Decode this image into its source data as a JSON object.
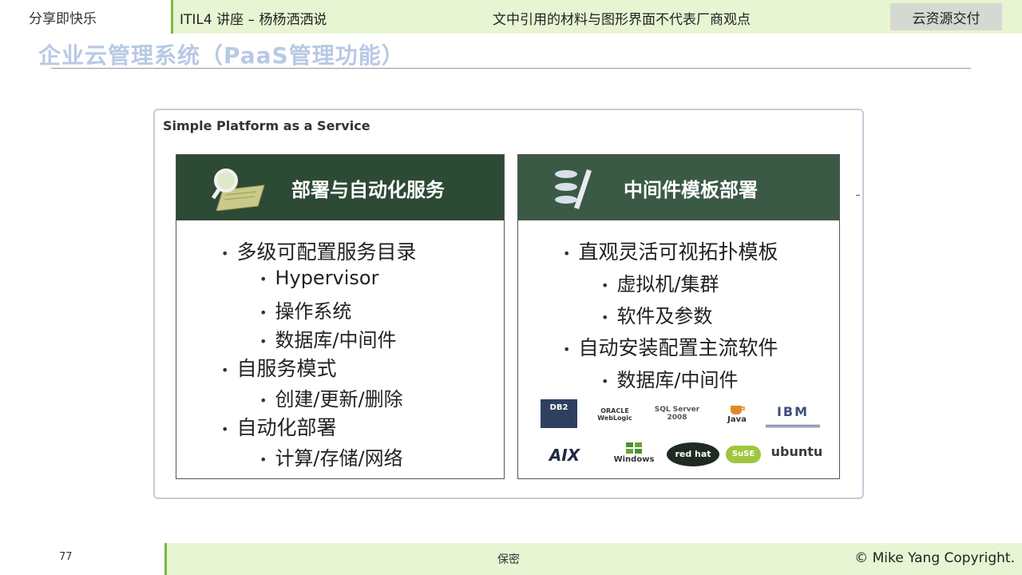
{
  "header": {
    "left_label": "分享即快乐",
    "lecture": "ITIL4 讲座 – 杨杨洒洒说",
    "disclaimer": "文中引用的材料与图形界面不代表厂商观点",
    "tag": "云资源交付"
  },
  "slide": {
    "title": "企业云管理系统（PaaS管理功能）",
    "frame_label": "Simple Platform as a Service",
    "left_panel": {
      "title": "部署与自动化服务",
      "icon": "magnifier-document-icon",
      "items": [
        {
          "level": 1,
          "text": "多级可配置服务目录"
        },
        {
          "level": 2,
          "text": "Hypervisor"
        },
        {
          "level": 2,
          "text": "操作系统"
        },
        {
          "level": 2,
          "text": "数据库/中间件"
        },
        {
          "level": 1,
          "text": "自服务模式"
        },
        {
          "level": 2,
          "text": "创建/更新/删除"
        },
        {
          "level": 1,
          "text": "自动化部署"
        },
        {
          "level": 2,
          "text": "计算/存储/网络"
        }
      ]
    },
    "right_panel": {
      "title": "中间件模板部署",
      "icon": "stacked-discs-icon",
      "items": [
        {
          "level": 1,
          "text": "直观灵活可视拓扑模板"
        },
        {
          "level": 2,
          "text": "虚拟机/集群"
        },
        {
          "level": 2,
          "text": "软件及参数"
        },
        {
          "level": 1,
          "text": "自动安装配置主流软件"
        },
        {
          "level": 2,
          "text": "数据库/中间件"
        }
      ],
      "logos": [
        "DB2",
        "ORACLE WebLogic",
        "SQL Server 2008",
        "Java",
        "IBM",
        "AIX",
        "Windows",
        "red hat",
        "SuSE",
        "ubuntu"
      ]
    }
  },
  "footer": {
    "page_number": "77",
    "classification": "保密",
    "copyright": "© Mike Yang Copyright."
  },
  "colors": {
    "accent_green": "#7fb844",
    "bar_bg": "#e8f5d2",
    "panel_head_left": "#2d4a34",
    "panel_head_right": "#3b5a45",
    "title_blue": "#b8c9e4"
  }
}
